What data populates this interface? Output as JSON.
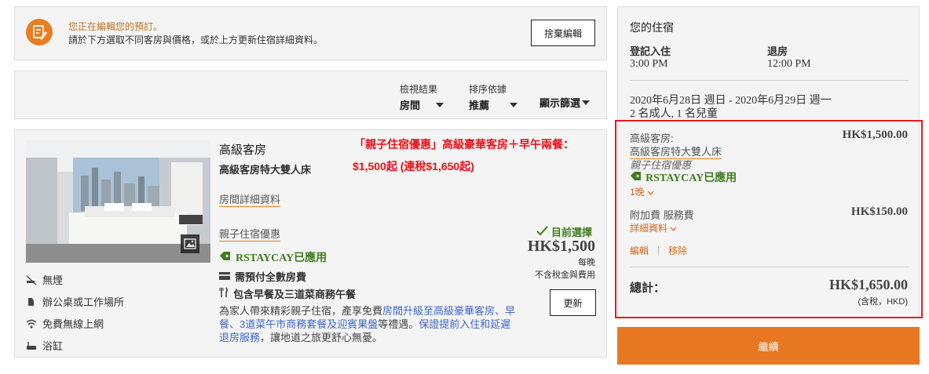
{
  "notice": {
    "line1": "您正在編輯您的預訂。",
    "line2": "請於下方選取不同客房與價格，或於上方更新住宿詳細資料。",
    "discard_label": "捨棄編輯"
  },
  "filters": {
    "view_label": "檢視結果",
    "view_value": "房間",
    "sort_label": "排序依據",
    "sort_value": "推薦",
    "show_filters": "顯示篩選"
  },
  "room": {
    "name": "高級客房",
    "bed": "高級客房特大雙人床",
    "details_link": "房間詳細資料",
    "promo_line1": "「親子住宿優惠」高級豪華客房＋早午兩餐：",
    "promo_line2": "$1,500起 (連稅$1,650起)",
    "amenities": [
      "無煙",
      "辦公桌或工作場所",
      "免費無線上網",
      "浴缸"
    ],
    "rate_name": "親子住宿優惠",
    "promo_code": "RSTAYCAY已應用",
    "feature_prepay": "需預付全數房費",
    "feature_meal": "包含早餐及三道菜商務午餐",
    "desc_a": "為家人帶來精彩親子住宿，產享免費",
    "desc_hl1": "房間升級至高級豪華客房、早餐、3道菜午市商務套餐及迎賓果盤",
    "desc_b": "等禮遇。",
    "desc_hl2": "保證提前入住和延遲退房服務",
    "desc_c": "，讓地道之旅更舒心無憂。",
    "selected_label": "目前選擇",
    "price": "HK$1,500",
    "per_night": "每晚",
    "tax_note": "不含稅金與費用",
    "update_label": "更新"
  },
  "summary": {
    "title": "您的住宿",
    "checkin_label": "登記入住",
    "checkin_time": "3:00 PM",
    "checkout_label": "退房",
    "checkout_time": "12:00 PM",
    "dates": "2020年6月28日 週日 - 2020年6月29日 週一",
    "guests": "2 名成人, 1 名兒童",
    "room_label": "高級客房:",
    "room_price": "HK$1,500.00",
    "room_bed": "高級客房特大雙人床",
    "rate_name": "親子住宿優惠",
    "promo_code": "RSTAYCAY已應用",
    "nights": "1晚",
    "extra_label": "附加費 服務費",
    "extra_price": "HK$150.00",
    "details_link": "詳細資料",
    "edit_label": "編輯",
    "remove_label": "移除",
    "total_label": "總計：",
    "total_price": "HK$1,650.00",
    "total_note": "(含稅，HKD)"
  },
  "continue_label": "繼續",
  "colors": {
    "accent": "#e87722",
    "highlight_box": "#e11b22",
    "promo_text": "#e8121a",
    "link_blue": "#3d66c9",
    "promo_green": "#3f7d1e"
  }
}
